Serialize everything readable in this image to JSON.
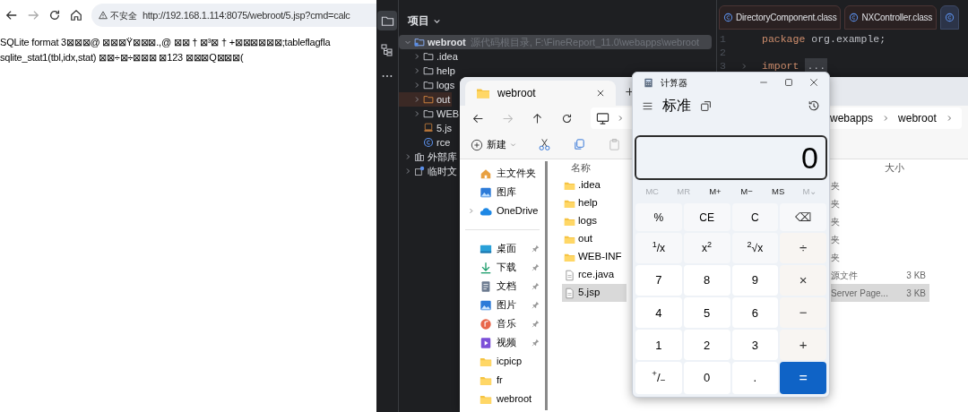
{
  "browser": {
    "security_label": "不安全",
    "url": "http://192.168.1.114:8075/webroot/5.jsp?cmd=calc",
    "content_lines": [
      "SQLite format 3⊠⊠⊠@ ⊠⊠⊠Ÿ⊠⊠⊠.,@ ⊠⊠ † ⊠³⊠ † +⊠⊠⊠⊠⊠⊠;tableflagfla",
      "sqlite_stat1(tbl,idx,stat) ⊠⊠÷⊠÷⊠⊠⊠ ⊠123 ⊠⊠⊠Q⊠⊠⊠("
    ]
  },
  "ide": {
    "project_header": "项目",
    "tree": [
      {
        "label": "webroot",
        "note": "源代码根目录, F:\\FineReport_11.0\\webapps\\webroot",
        "kind": "module",
        "expanded": true,
        "selected": true,
        "children": [
          {
            "label": ".idea",
            "kind": "folder",
            "expanded": false,
            "selected": false
          },
          {
            "label": "help",
            "kind": "folder",
            "expanded": false,
            "selected": false
          },
          {
            "label": "logs",
            "kind": "folder",
            "expanded": false,
            "selected": false
          },
          {
            "label": "out",
            "kind": "excluded",
            "expanded": false,
            "selected": false
          },
          {
            "label": "WEB",
            "kind": "folder",
            "expanded": false,
            "selected": false
          },
          {
            "label": "5.js",
            "kind": "jsp",
            "selected": false
          },
          {
            "label": "rce",
            "kind": "class",
            "selected": false
          }
        ]
      },
      {
        "label": "外部库",
        "kind": "library",
        "expanded": false,
        "selected": false
      },
      {
        "label": "临时文",
        "kind": "scratch",
        "expanded": false,
        "selected": false
      }
    ],
    "tabs": [
      {
        "label": "DirectoryComponent.class",
        "selected": false
      },
      {
        "label": "NXController.class",
        "selected": false
      },
      {
        "selected": true
      }
    ],
    "code_lines": [
      {
        "number": "1",
        "tokens": [
          {
            "kind": "keyword",
            "text": "package"
          },
          {
            "kind": "plain",
            "text": "org.example;"
          }
        ]
      },
      {
        "number": "2"
      },
      {
        "number": "3",
        "folded": true,
        "tokens": [
          {
            "kind": "keyword",
            "text": "import"
          },
          {
            "kind": "fold",
            "text": "..."
          }
        ]
      }
    ]
  },
  "explorer": {
    "tab_title": "webroot",
    "breadcrumb_end": [
      "webapps",
      "webroot"
    ],
    "new_label": "新建",
    "sidebar_groups": [
      [
        {
          "label": "主文件夹",
          "kind": "home",
          "pinned": false
        },
        {
          "label": "图库",
          "kind": "gallery",
          "pinned": false
        },
        {
          "label": "OneDrive",
          "kind": "cloud",
          "pinned": false,
          "expanded": false
        }
      ],
      [
        {
          "label": "桌面",
          "kind": "desktop",
          "pinned": true
        },
        {
          "label": "下载",
          "kind": "download",
          "pinned": true
        },
        {
          "label": "文档",
          "kind": "document",
          "pinned": true
        },
        {
          "label": "图片",
          "kind": "picture",
          "pinned": true
        },
        {
          "label": "音乐",
          "kind": "music",
          "pinned": true
        },
        {
          "label": "视频",
          "kind": "video",
          "pinned": true
        },
        {
          "label": "icpicp",
          "kind": "folder",
          "pinned": false
        },
        {
          "label": "fr",
          "kind": "folder",
          "pinned": false
        },
        {
          "label": "webroot",
          "kind": "folder",
          "pinned": false
        }
      ]
    ],
    "columns": [
      "名称",
      "大小"
    ],
    "files": [
      {
        "name": ".idea",
        "kind": "folder",
        "type": "夹",
        "selected": false
      },
      {
        "name": "help",
        "kind": "folder",
        "type": "夹",
        "selected": false
      },
      {
        "name": "logs",
        "kind": "folder",
        "type": "夹",
        "selected": false
      },
      {
        "name": "out",
        "kind": "folder",
        "type": "夹",
        "selected": false
      },
      {
        "name": "WEB-INF",
        "kind": "folder",
        "type": "夹",
        "selected": false
      },
      {
        "name": "rce.java",
        "kind": "file",
        "type": "源文件",
        "size": "3 KB",
        "selected": false
      },
      {
        "name": "5.jsp",
        "kind": "file",
        "type": "Server Page...",
        "size": "3 KB",
        "selected": true
      }
    ]
  },
  "calculator": {
    "title": "计算器",
    "mode": "标准",
    "display": "0",
    "memory": [
      {
        "label": "MC",
        "disabled": true
      },
      {
        "label": "MR",
        "disabled": true
      },
      {
        "label": "M+",
        "disabled": false
      },
      {
        "label": "M−",
        "disabled": false
      },
      {
        "label": "MS",
        "disabled": false
      },
      {
        "label": "M⌄",
        "disabled": true
      }
    ],
    "keys": [
      {
        "label": "%",
        "kind": "function"
      },
      {
        "label": "CE",
        "kind": "function"
      },
      {
        "label": "C",
        "kind": "function"
      },
      {
        "label": "⌫",
        "kind": "backspace"
      },
      {
        "label": "$^{1}$/x",
        "kind": "function"
      },
      {
        "label": "x$^{2}$",
        "kind": "function"
      },
      {
        "label": "$^{2}$√x",
        "kind": "function"
      },
      {
        "label": "÷",
        "kind": "operator"
      },
      {
        "label": "7",
        "kind": "digit"
      },
      {
        "label": "8",
        "kind": "digit"
      },
      {
        "label": "9",
        "kind": "digit"
      },
      {
        "label": "×",
        "kind": "operator"
      },
      {
        "label": "4",
        "kind": "digit"
      },
      {
        "label": "5",
        "kind": "digit"
      },
      {
        "label": "6",
        "kind": "digit"
      },
      {
        "label": "−",
        "kind": "operator"
      },
      {
        "label": "1",
        "kind": "digit"
      },
      {
        "label": "2",
        "kind": "digit"
      },
      {
        "label": "3",
        "kind": "digit"
      },
      {
        "label": "+",
        "kind": "operator"
      },
      {
        "label": "$^{+}$/$_{−}$",
        "kind": "digit"
      },
      {
        "label": "0",
        "kind": "digit"
      },
      {
        "label": ".",
        "kind": "digit"
      },
      {
        "label": "=",
        "kind": "equals"
      }
    ]
  }
}
